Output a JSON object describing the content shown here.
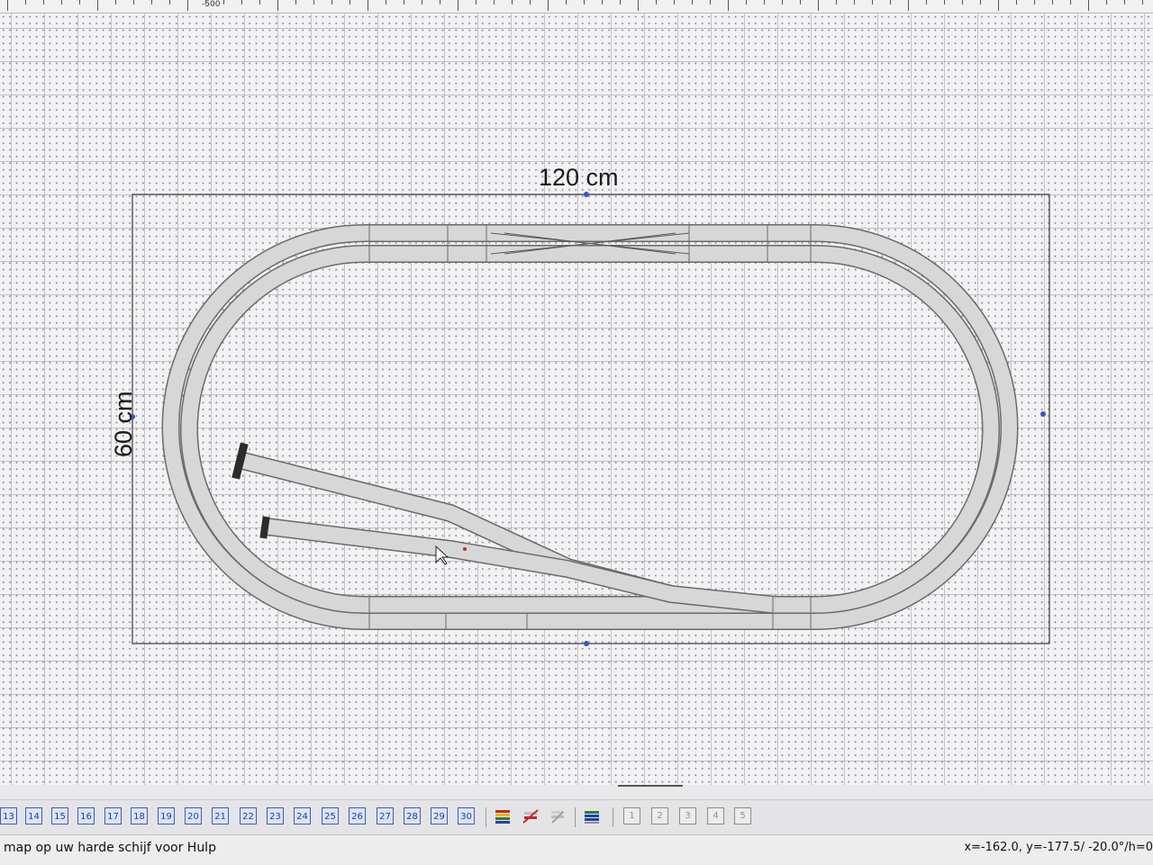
{
  "ruler": {
    "labels": [
      "-500"
    ]
  },
  "board": {
    "width_label": "120 cm",
    "height_label": "60 cm"
  },
  "toolbar": {
    "layer_buttons": [
      "13",
      "14",
      "15",
      "16",
      "17",
      "18",
      "19",
      "20",
      "21",
      "22",
      "23",
      "24",
      "25",
      "26",
      "27",
      "28",
      "29",
      "30"
    ],
    "tools": [
      "layers-icon",
      "layer-hide-icon",
      "layer-lock-icon",
      "layer-stack-icon"
    ],
    "view_buttons": [
      "1",
      "2",
      "3",
      "4",
      "5"
    ]
  },
  "status": {
    "hint": "map op uw harde schijf voor Hulp",
    "coords": "x=-162.0, y=-177.5/ -20.0°/h=0"
  }
}
